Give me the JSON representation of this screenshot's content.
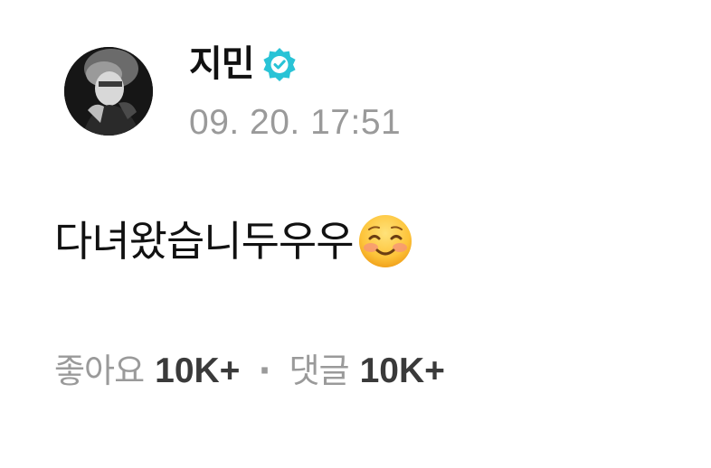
{
  "author": {
    "name": "지민",
    "verified": true,
    "verified_color": "#29c3d6",
    "avatar_icon": "profile-photo"
  },
  "post": {
    "timestamp": "09. 20. 17:51",
    "text": "다녀왔습니두우우",
    "emoji": "smiling-face-icon"
  },
  "stats": {
    "likes_label": "좋아요",
    "likes_value": "10K+",
    "separator": "·",
    "comments_label": "댓글",
    "comments_value": "10K+"
  },
  "colors": {
    "text_primary": "#111111",
    "text_secondary": "#9a9a9a",
    "stat_value": "#3a3a3a",
    "background": "#ffffff"
  }
}
